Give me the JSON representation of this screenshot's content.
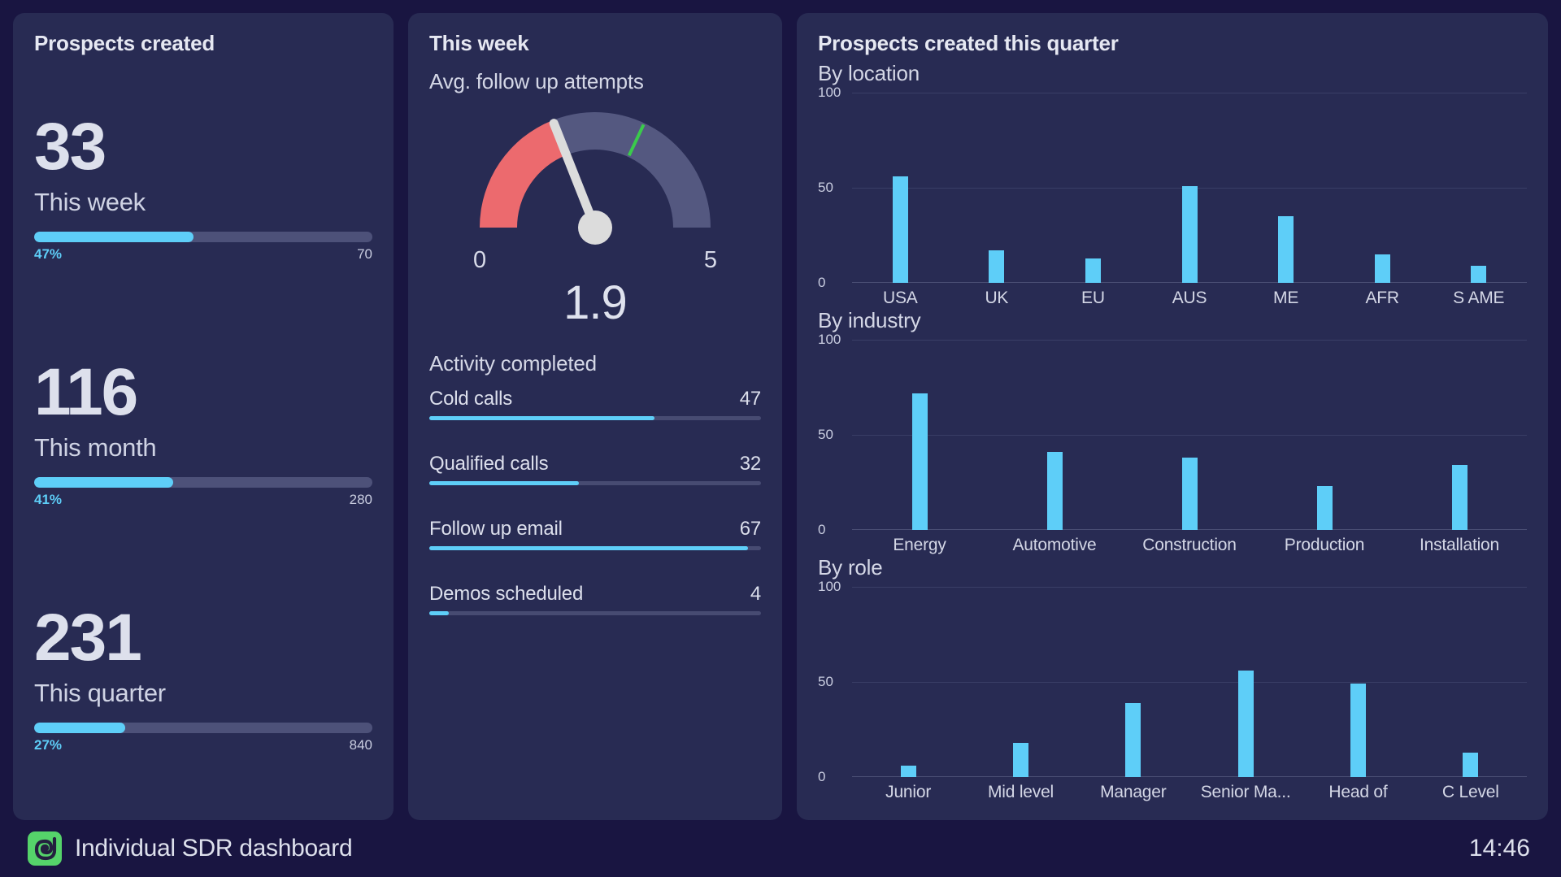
{
  "theme": {
    "page_bg": "#191541",
    "card_bg": "#282B53",
    "accent_blue": "#5ECEF8",
    "track_grey": "#4D5179",
    "gauge_red": "#EC6A6E",
    "gauge_grey": "#545880",
    "threshold_green": "#3ACB4B",
    "logo_green": "#55D36A",
    "text_primary": "#DDE0EC"
  },
  "left_panel": {
    "title": "Prospects created",
    "stats": [
      {
        "value": "33",
        "caption": "This week",
        "percent_label": "47%",
        "percent": 47,
        "max_label": "70"
      },
      {
        "value": "116",
        "caption": "This month",
        "percent_label": "41%",
        "percent": 41,
        "max_label": "280"
      },
      {
        "value": "231",
        "caption": "This quarter",
        "percent_label": "27%",
        "percent": 27,
        "max_label": "840"
      }
    ]
  },
  "mid_panel": {
    "title": "This week",
    "gauge_label": "Avg. follow up attempts",
    "gauge": {
      "value": "1.9",
      "value_number": 1.9,
      "min_label": "0",
      "max_label": "5",
      "min": 0,
      "max": 5,
      "threshold": 3.2,
      "red_zone_end": 1.9
    },
    "activity_title": "Activity completed",
    "activities": [
      {
        "label": "Cold calls",
        "value": "47",
        "percent": 68
      },
      {
        "label": "Qualified calls",
        "value": "32",
        "percent": 45
      },
      {
        "label": "Follow up email",
        "value": "67",
        "percent": 96
      },
      {
        "label": "Demos scheduled",
        "value": "4",
        "percent": 6
      }
    ]
  },
  "right_panel": {
    "title": "Prospects created this quarter"
  },
  "chart_data": [
    {
      "type": "bar",
      "title": "By location",
      "categories": [
        "USA",
        "UK",
        "EU",
        "AUS",
        "ME",
        "AFR",
        "S AME"
      ],
      "values": [
        56,
        17,
        13,
        51,
        35,
        15,
        9
      ],
      "ylim": [
        0,
        100
      ],
      "yticks": [
        0,
        50,
        100
      ],
      "ytick_labels": [
        "0",
        "50",
        "100"
      ],
      "xlabel": "",
      "ylabel": "",
      "grid": true,
      "legend": "none"
    },
    {
      "type": "bar",
      "title": "By industry",
      "categories": [
        "Energy",
        "Automotive",
        "Construction",
        "Production",
        "Installation"
      ],
      "values": [
        72,
        41,
        38,
        23,
        34
      ],
      "ylim": [
        0,
        100
      ],
      "yticks": [
        0,
        50,
        100
      ],
      "ytick_labels": [
        "0",
        "50",
        "100"
      ],
      "xlabel": "",
      "ylabel": "",
      "grid": true,
      "legend": "none"
    },
    {
      "type": "bar",
      "title": "By role",
      "categories": [
        "Junior",
        "Mid level",
        "Manager",
        "Senior Ma...",
        "Head of",
        "C Level"
      ],
      "values": [
        6,
        18,
        39,
        56,
        49,
        13
      ],
      "ylim": [
        0,
        100
      ],
      "yticks": [
        0,
        50,
        100
      ],
      "ytick_labels": [
        "0",
        "50",
        "100"
      ],
      "xlabel": "",
      "ylabel": "",
      "grid": true,
      "legend": "none"
    }
  ],
  "footer": {
    "logo_icon": "spiral-leaf-logo",
    "title": "Individual SDR dashboard",
    "clock": "14:46"
  }
}
